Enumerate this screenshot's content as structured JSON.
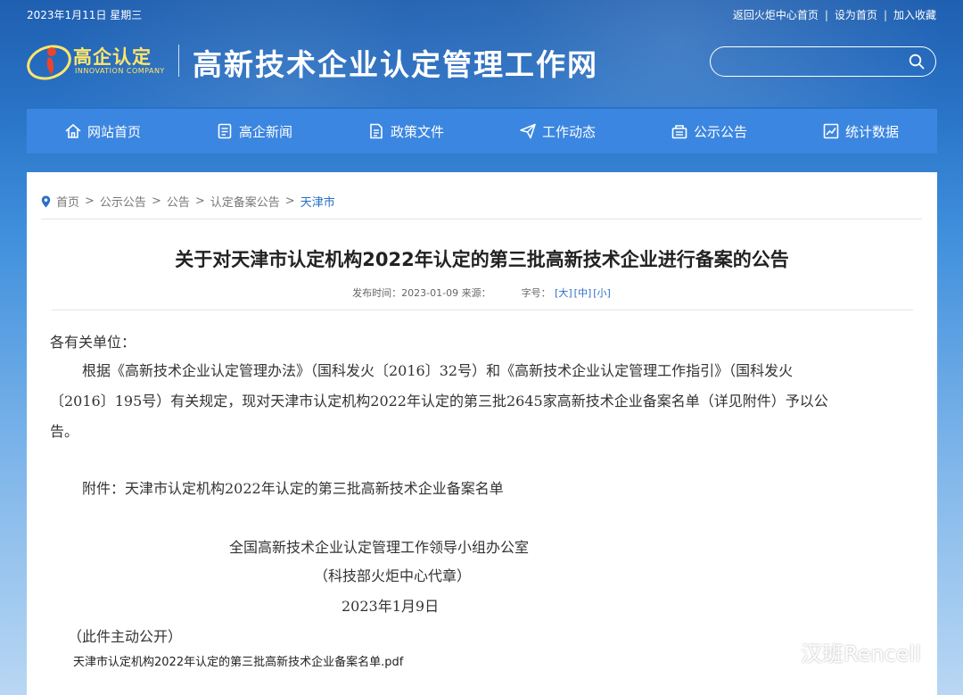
{
  "topbar": {
    "date": "2023年1月11日 星期三",
    "links": [
      "返回火炬中心首页",
      "设为首页",
      "加入收藏"
    ]
  },
  "logo": {
    "cn": "高企认定",
    "en": "INNOVATION COMPANY"
  },
  "site_title": "高新技术企业认定管理工作网",
  "search": {
    "value": "",
    "icon": "search-icon"
  },
  "nav": [
    {
      "label": "网站首页",
      "icon": "home-icon"
    },
    {
      "label": "高企新闻",
      "icon": "news-icon"
    },
    {
      "label": "政策文件",
      "icon": "document-icon"
    },
    {
      "label": "工作动态",
      "icon": "send-icon"
    },
    {
      "label": "公示公告",
      "icon": "notice-icon"
    },
    {
      "label": "统计数据",
      "icon": "chart-icon"
    }
  ],
  "breadcrumb": {
    "items": [
      "首页",
      "公示公告",
      "公告",
      "认定备案公告"
    ],
    "current": "天津市"
  },
  "article": {
    "title": "关于对天津市认定机构2022年认定的第三批高新技术企业进行备案的公告",
    "meta_time": "发布时间：2023-01-09 来源：",
    "meta_font": "字号：",
    "font_sizes": [
      "[大]",
      "[中]",
      "[小]"
    ],
    "salutation": "各有关单位：",
    "para1_l1": "根据《高新技术企业认定管理办法》（国科发火〔2016〕32号）和《高新技术企业认定管理工作指引》（国科发火",
    "para1_l2": "〔2016〕195号）有关规定，现对天津市认定机构2022年认定的第三批2645家高新技术企业备案名单（详见附件）予以公",
    "para1_l3": "告。",
    "attachment_line": "附件：天津市认定机构2022年认定的第三批高新技术企业备案名单",
    "signature_org": "全国高新技术企业认定管理工作领导小组办公室",
    "signature_seal": "（科技部火炬中心代章）",
    "signature_date": "2023年1月9日",
    "disclosure": "（此件主动公开）",
    "attachment_file": "天津市认定机构2022年认定的第三批高新技术企业备案名单.pdf"
  },
  "watermark": "汉班Rencell"
}
